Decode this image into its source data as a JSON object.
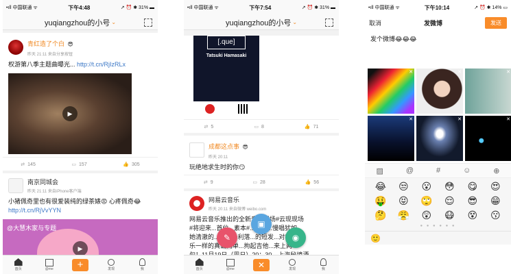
{
  "colors": {
    "accent": "#f98c2a",
    "link": "#3b77c6",
    "username": "#f08a24"
  },
  "status1": {
    "carrier": "•ıll 中国联通 ᯤ",
    "time": "下午4:48",
    "battery": "↗ ⏰ ✱ 31% ▬"
  },
  "status2": {
    "carrier": "•ıll 中国联通 ᯤ",
    "time": "下午7:54",
    "battery": "↗ ⏰ ✱ 31% ▬"
  },
  "status3": {
    "carrier": "•ıll 中国联通 ᯤ",
    "time": "下午10:14",
    "battery": "↗ ⏰ ✱ 14% ▭"
  },
  "nav": {
    "title": "yuqiangzhou的小号",
    "chevron": "⌄"
  },
  "feed1": {
    "post1": {
      "author": "青红造了个白",
      "badge": "😎",
      "meta": "昨天 21:11  来自分享按钮",
      "text": "权游第八季主题曲曝光...",
      "link": "http://t.cn/RjIzRLx",
      "reposts": "145",
      "comments": "157",
      "likes": "305"
    },
    "post2": {
      "author": "南京同城会",
      "meta": "昨天 21:11  来自iPhone客户端",
      "text": "小猪佩奇里也有很爱装纯的绿茶婊😡 心疼佩奇😂",
      "link": "http://t.cn/RjVvYYN",
      "watermark": "@大慧木家与专题"
    }
  },
  "feed2": {
    "poster": {
      "title": "[.que]",
      "name": "Tatsuki Hamasaki"
    },
    "actions1": {
      "reposts": "5",
      "comments": "8",
      "likes": "71"
    },
    "post2": {
      "author": "成都这点事",
      "badge": "😎",
      "meta": "昨天 20:11",
      "text": "玩绝地求生时的你😏",
      "reposts": "9",
      "comments": "28",
      "likes": "56"
    },
    "post3": {
      "author": "网易云音乐",
      "meta": "昨天 20:11  来自微博 weibo.com",
      "text": "网易云音乐推出的全新音乐现场#云现现场",
      "text2": "#将迎来...首位...素本#...简单...慢唱犹如",
      "text3": "她清澈的...声干净利落...的短发...对待音",
      "text4": "乐一样的真诚简单...拘起吉他...来上两",
      "text5": "句！11月19日（周日）20：30，上海秘境酒"
    }
  },
  "tabs": [
    {
      "label": "首页"
    },
    {
      "label": "@me"
    },
    {
      "label": "+"
    },
    {
      "label": "发现"
    },
    {
      "label": "我"
    }
  ],
  "tabs2": [
    {
      "label": "首页"
    },
    {
      "label": "@me"
    },
    {
      "label": "✕"
    },
    {
      "label": "发现"
    },
    {
      "label": "我"
    }
  ],
  "compose": {
    "cancel": "取消",
    "title": "发微博",
    "send": "发送",
    "draft": "发个微博😂😂😂",
    "emojis": [
      "😂",
      "😒",
      "😮",
      "😳",
      "😋",
      "😍",
      "🤑",
      "😝",
      "🙄",
      "😌",
      "😎",
      "😁",
      "🤔",
      "😤",
      "😲",
      "😷",
      "😵",
      "😗"
    ],
    "page_dots": "● ● ● ● ● ●",
    "bottom_emoji": "🙂"
  }
}
